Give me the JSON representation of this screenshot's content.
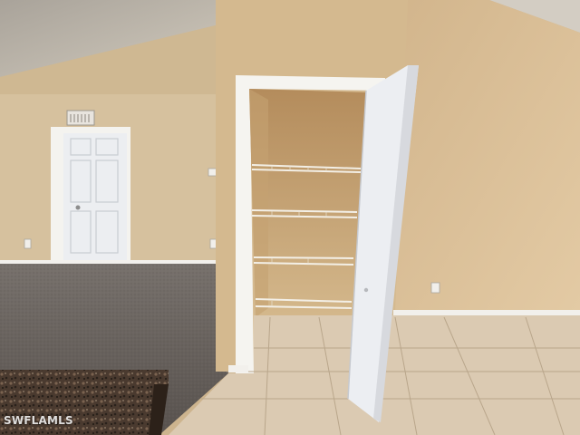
{
  "photo": {
    "watermark": "SWFLAMLS",
    "palette": {
      "ceiling": "#c9c2b4",
      "wall_left": "#d8c3a0",
      "wall_center": "#cfb58e",
      "wall_right": "#d9bf97",
      "carpet": "#67615d",
      "tile": "#d9c8b0",
      "door": "#eef0f4",
      "granite": "#3e3128"
    }
  }
}
